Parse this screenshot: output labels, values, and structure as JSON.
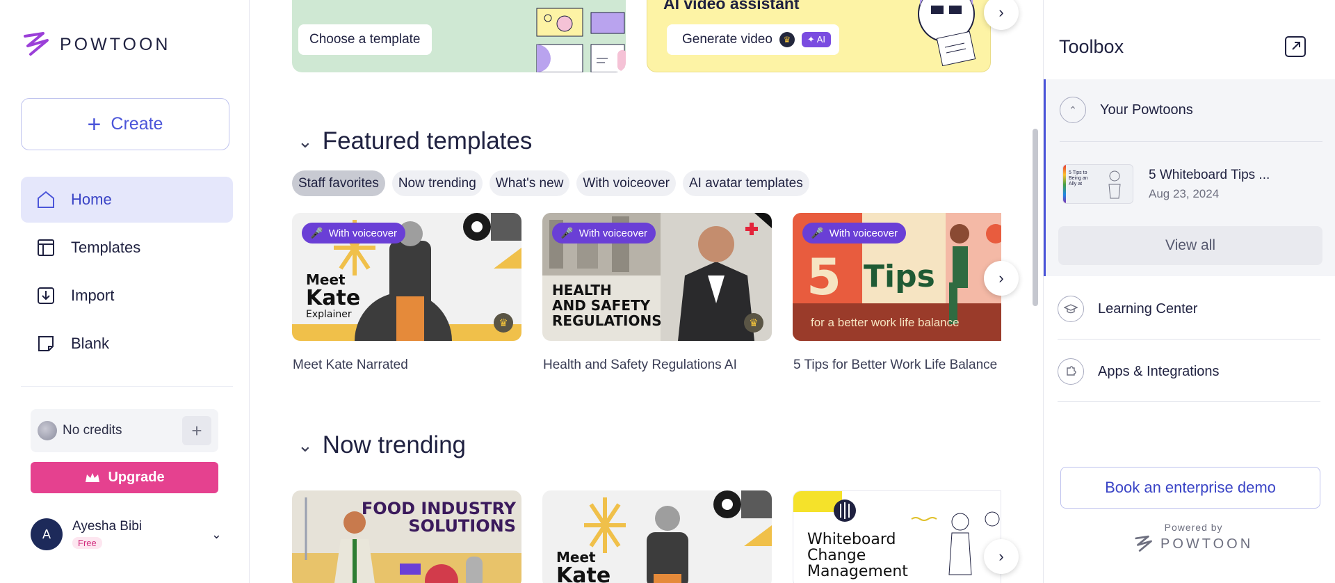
{
  "brand": {
    "name": "POWTOON",
    "accent": "#4b55d9",
    "pink": "#e5418f"
  },
  "sidebar": {
    "create_label": "Create",
    "nav": [
      {
        "label": "Home",
        "icon": "home-icon",
        "active": true
      },
      {
        "label": "Templates",
        "icon": "templates-icon",
        "active": false
      },
      {
        "label": "Import",
        "icon": "import-icon",
        "active": false
      },
      {
        "label": "Blank",
        "icon": "blank-icon",
        "active": false
      }
    ],
    "credits_label": "No credits",
    "upgrade_label": "Upgrade",
    "user": {
      "initial": "A",
      "name": "Ayesha Bibi",
      "plan": "Free"
    }
  },
  "banners": {
    "template_button": "Choose a template",
    "ai_title": "AI video assistant",
    "ai_button": "Generate video",
    "ai_badge": "AI"
  },
  "featured": {
    "title": "Featured templates",
    "chips": [
      "Staff favorites",
      "Now trending",
      "What's new",
      "With voiceover",
      "AI avatar templates"
    ],
    "active_chip": "Staff favorites",
    "cards": [
      {
        "badge": "With voiceover",
        "label": "Meet Kate Narrated",
        "art_line1": "Meet",
        "art_line2": "Kate",
        "art_line3": "Explainer"
      },
      {
        "badge": "With voiceover",
        "label": "Health and Safety Regulations AI",
        "art_line1": "HEALTH",
        "art_line2": "AND SAFETY",
        "art_line3": "REGULATIONS"
      },
      {
        "badge": "With voiceover",
        "label": "5 Tips for Better Work Life Balance",
        "art_line1": "5",
        "art_line2": "Tips",
        "art_line3": "for a better work life balance"
      }
    ]
  },
  "trending": {
    "title": "Now trending",
    "cards": [
      {
        "art_line1": "FOOD INDUSTRY",
        "art_line2": "SOLUTIONS"
      },
      {
        "art_line1": "Meet",
        "art_line2": "Kate"
      },
      {
        "art_line1": "Whiteboard",
        "art_line2": "Change",
        "art_line3": "Management"
      }
    ]
  },
  "toolbox": {
    "title": "Toolbox",
    "your_powtoons": "Your Powtoons",
    "recent": {
      "title": "5 Whiteboard Tips ...",
      "date": "Aug 23, 2024",
      "thumb_text": "5 Tips to Being an Ally at"
    },
    "view_all": "View all",
    "learning_center": "Learning Center",
    "apps": "Apps & Integrations",
    "demo_button": "Book an enterprise demo",
    "powered_by": "Powered by",
    "powered_logo": "POWTOON"
  }
}
